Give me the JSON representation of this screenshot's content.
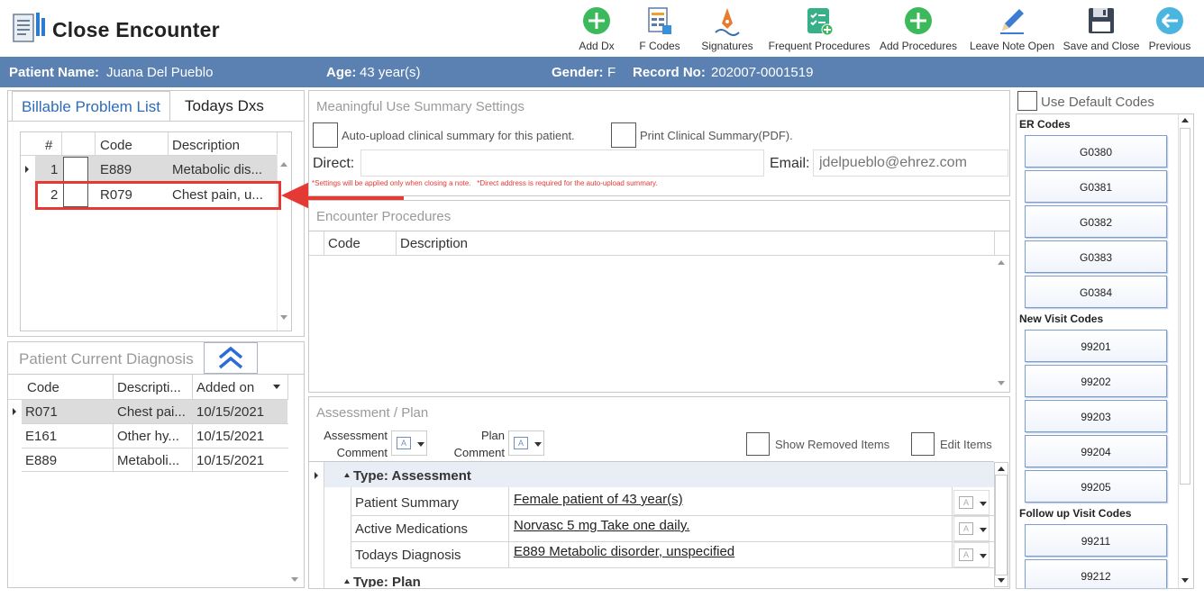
{
  "app": {
    "title": "Close Encounter"
  },
  "toolbar": {
    "add_dx": "Add Dx",
    "f_codes": "F Codes",
    "signatures": "Signatures",
    "frequent_procedures": "Frequent Procedures",
    "add_procedures": "Add Procedures",
    "leave_note_open": "Leave Note Open",
    "save_and_close": "Save and Close",
    "previous": "Previous"
  },
  "patient": {
    "name_label": "Patient Name:",
    "name": "Juana Del Pueblo",
    "age_label": "Age:",
    "age": "43 year(s)",
    "gender_label": "Gender:",
    "gender": "F",
    "record_label": "Record No:",
    "record": "202007-0001519"
  },
  "problems": {
    "tab_billable": "Billable Problem List",
    "tab_todays": "Todays Dxs",
    "col_num": "#",
    "col_code": "Code",
    "col_desc": "Description",
    "rows": [
      {
        "num": "1",
        "code": "E889",
        "desc": "Metabolic dis..."
      },
      {
        "num": "2",
        "code": "R079",
        "desc": "Chest pain, u..."
      }
    ]
  },
  "current_dx": {
    "title": "Patient Current Diagnosis",
    "col_code": "Code",
    "col_desc": "Descripti...",
    "col_added": "Added on",
    "rows": [
      {
        "code": "R071",
        "desc": "Chest pai...",
        "added": "10/15/2021"
      },
      {
        "code": "E161",
        "desc": "Other hy...",
        "added": "10/15/2021"
      },
      {
        "code": "E889",
        "desc": "Metaboli...",
        "added": "10/15/2021"
      }
    ]
  },
  "mu": {
    "title": "Meaningful Use Summary Settings",
    "auto_upload": "Auto-upload clinical summary for this patient.",
    "print_summary": "Print Clinical Summary(PDF).",
    "direct_label": "Direct:",
    "direct_value": "",
    "email_label": "Email:",
    "email_placeholder": "jdelpueblo@ehrez.com",
    "note1": "*Settings will be applied only when closing a note.",
    "note2": "*Direct address is required for the auto-upload summary."
  },
  "procedures": {
    "title": "Encounter Procedures",
    "col_code": "Code",
    "col_desc": "Description"
  },
  "ap": {
    "title": "Assessment / Plan",
    "assessment_comment_1": "Assessment",
    "assessment_comment_2": "Comment",
    "plan_comment_1": "Plan",
    "plan_comment_2": "Comment",
    "show_removed": "Show Removed Items",
    "edit_items": "Edit Items",
    "group_assessment": "Type: Assessment",
    "group_plan": "Type: Plan",
    "rows": [
      {
        "label": "Patient Summary",
        "value": "Female patient of 43 year(s)"
      },
      {
        "label": "Active Medications",
        "value": "Norvasc 5 mg Take one daily. "
      },
      {
        "label": "Todays Diagnosis",
        "value": " E889 Metabolic disorder, unspecified"
      }
    ]
  },
  "codes": {
    "use_default": "Use Default Codes",
    "er_title": "ER Codes",
    "er": [
      "G0380",
      "G0381",
      "G0382",
      "G0383",
      "G0384"
    ],
    "new_title": "New Visit Codes",
    "new": [
      "99201",
      "99202",
      "99203",
      "99204",
      "99205"
    ],
    "follow_title": "Follow up Visit Codes",
    "follow": [
      "99211",
      "99212"
    ]
  },
  "colors": {
    "header_bar": "#5b80b2",
    "accent_green": "#3cb95a",
    "annotation_red": "#e53935",
    "tab_blue": "#2e6bb8"
  }
}
